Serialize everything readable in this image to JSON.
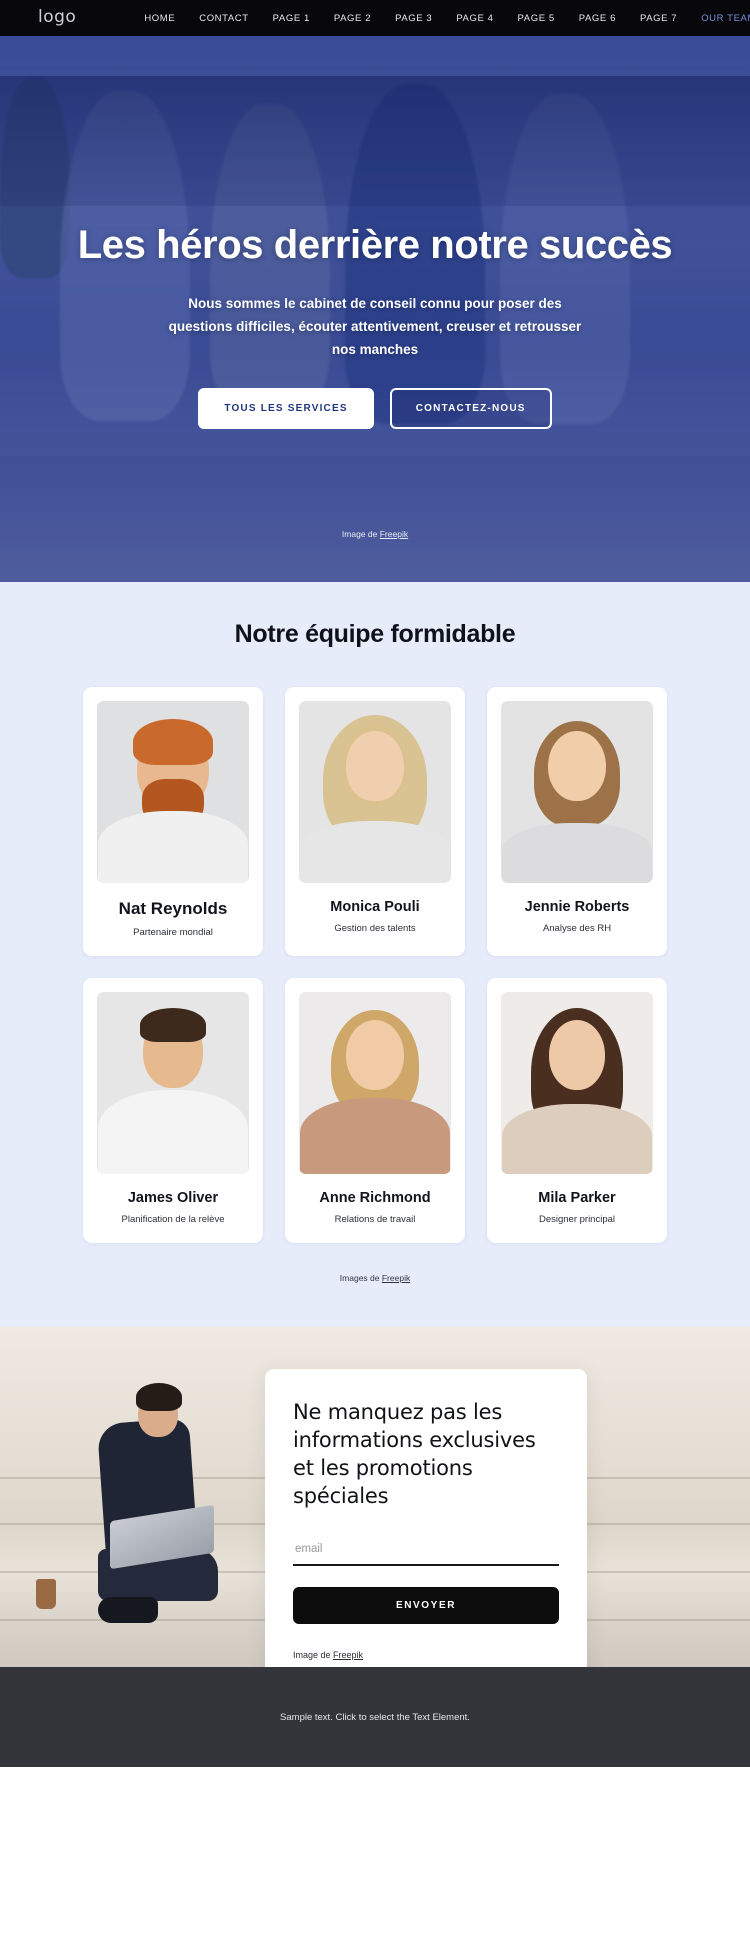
{
  "nav": {
    "logo": "logo",
    "links": [
      {
        "label": "HOME",
        "active": false
      },
      {
        "label": "CONTACT",
        "active": false
      },
      {
        "label": "PAGE 1",
        "active": false
      },
      {
        "label": "PAGE 2",
        "active": false
      },
      {
        "label": "PAGE 3",
        "active": false
      },
      {
        "label": "PAGE 4",
        "active": false
      },
      {
        "label": "PAGE 5",
        "active": false
      },
      {
        "label": "PAGE 6",
        "active": false
      },
      {
        "label": "PAGE 7",
        "active": false
      },
      {
        "label": "OUR TEAM",
        "active": true
      }
    ],
    "active_color": "#7b8ddb",
    "bg_color": "#08080c"
  },
  "hero": {
    "title": "Les héros derrière notre succès",
    "subtitle": "Nous sommes le cabinet de conseil connu pour poser des questions difficiles, écouter attentivement, creuser et retrousser nos manches",
    "primary_button": "TOUS LES SERVICES",
    "secondary_button": "CONTACTEZ-NOUS",
    "credit_prefix": "Image de ",
    "credit_link": "Freepik",
    "overlay_color": "#25389a"
  },
  "team": {
    "title": "Notre équipe formidable",
    "bg_color": "#e7ecfb",
    "credit_prefix": "Images de ",
    "credit_link": "Freepik",
    "members": [
      {
        "name": "Nat Reynolds",
        "role": "Partenaire mondial",
        "emphasis": true
      },
      {
        "name": "Monica Pouli",
        "role": "Gestion des talents",
        "emphasis": false
      },
      {
        "name": "Jennie Roberts",
        "role": "Analyse des RH",
        "emphasis": false
      },
      {
        "name": "James Oliver",
        "role": "Planification de la relève",
        "emphasis": false
      },
      {
        "name": "Anne Richmond",
        "role": "Relations de travail",
        "emphasis": false
      },
      {
        "name": "Mila Parker",
        "role": "Designer principal",
        "emphasis": false
      }
    ]
  },
  "newsletter": {
    "title": "Ne manquez pas les informations exclusives et les promotions spéciales",
    "email_placeholder": "email",
    "email_value": "",
    "submit_label": "ENVOYER",
    "credit_prefix": "Image de ",
    "credit_link": "Freepik",
    "button_color": "#0c0c0c"
  },
  "footer": {
    "text": "Sample text. Click to select the Text Element.",
    "bg_color": "#33353a"
  }
}
